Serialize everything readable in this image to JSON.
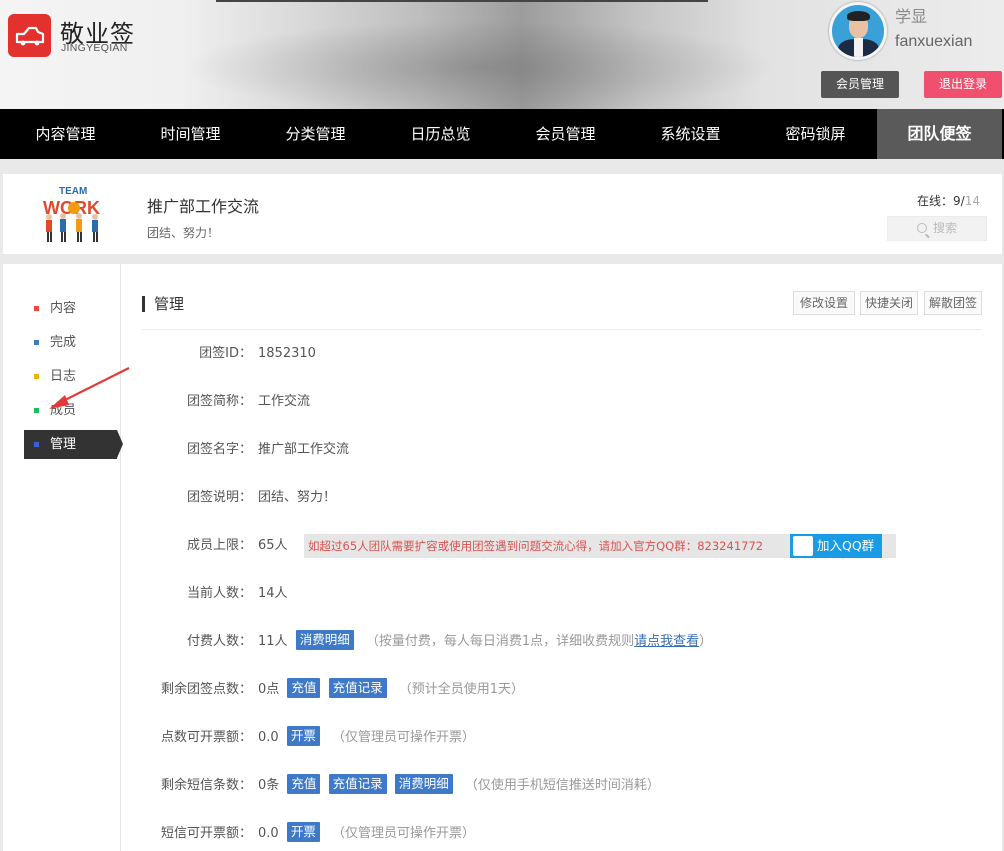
{
  "brand": {
    "name": "敬业签",
    "pinyin": "JINGYEQIAN",
    "color": "#e3312e"
  },
  "user": {
    "name": "学显",
    "login": "fanxuexian",
    "member_btn": "会员管理",
    "logout_btn": "退出登录"
  },
  "nav": {
    "items": [
      "内容管理",
      "时间管理",
      "分类管理",
      "日历总览",
      "会员管理",
      "系统设置",
      "密码锁屏",
      "团队便签"
    ],
    "active_index": 7
  },
  "team": {
    "name": "推广部工作交流",
    "motto": "团结、努力！",
    "online_label": "在线：",
    "online_count": "9",
    "online_sep": "/",
    "online_total": "14",
    "search_placeholder": "搜索"
  },
  "sidebar": {
    "items": [
      {
        "label": "内容",
        "dot_color": "#e74c3c"
      },
      {
        "label": "完成",
        "dot_color": "#3f7ac8"
      },
      {
        "label": "日志",
        "dot_color": "#f0b400"
      },
      {
        "label": "成员",
        "dot_color": "#1bbc5b"
      },
      {
        "label": "管理",
        "dot_color": "#3a5fd8"
      }
    ],
    "active_index": 4
  },
  "panel": {
    "title": "管理",
    "buttons": [
      "修改设置",
      "快捷关闭",
      "解散团签"
    ]
  },
  "fields": {
    "id": {
      "label": "团签ID：",
      "value": "1852310"
    },
    "short_name": {
      "label": "团签简称：",
      "value": "工作交流"
    },
    "full_name": {
      "label": "团签名字：",
      "value": "推广部工作交流"
    },
    "desc": {
      "label": "团签说明：",
      "value": "团结、努力！"
    },
    "limit": {
      "label": "成员上限：",
      "value": "65人",
      "notice": "如超过65人团队需要扩容或使用团签遇到问题交流心得，请加入官方QQ群：823241772",
      "qq_btn": "加入QQ群"
    },
    "current": {
      "label": "当前人数：",
      "value": "14人"
    },
    "paid": {
      "label": "付费人数：",
      "value": "11人",
      "tag": "消费明细",
      "hint_pre": "（按量付费，每人每日消费1点，详细收费规则",
      "hint_link": "请点我查看",
      "hint_post": "）"
    },
    "points": {
      "label": "剩余团签点数：",
      "value": "0点",
      "tag1": "充值",
      "tag2": "充值记录",
      "hint": "（预计全员使用1天）"
    },
    "invoice": {
      "label": "点数可开票额：",
      "value": "0.0",
      "tag": "开票",
      "hint": "（仅管理员可操作开票）"
    },
    "sms": {
      "label": "剩余短信条数：",
      "value": "0条",
      "tag1": "充值",
      "tag2": "充值记录",
      "tag3": "消费明细",
      "hint": "（仅使用手机短信推送时间消耗）"
    },
    "sms_invoice": {
      "label": "短信可开票额：",
      "value": "0.0",
      "tag": "开票",
      "hint": "（仅管理员可操作开票）"
    }
  },
  "team_logo_text": {
    "top": "TEAM",
    "bottom": "WORK"
  }
}
